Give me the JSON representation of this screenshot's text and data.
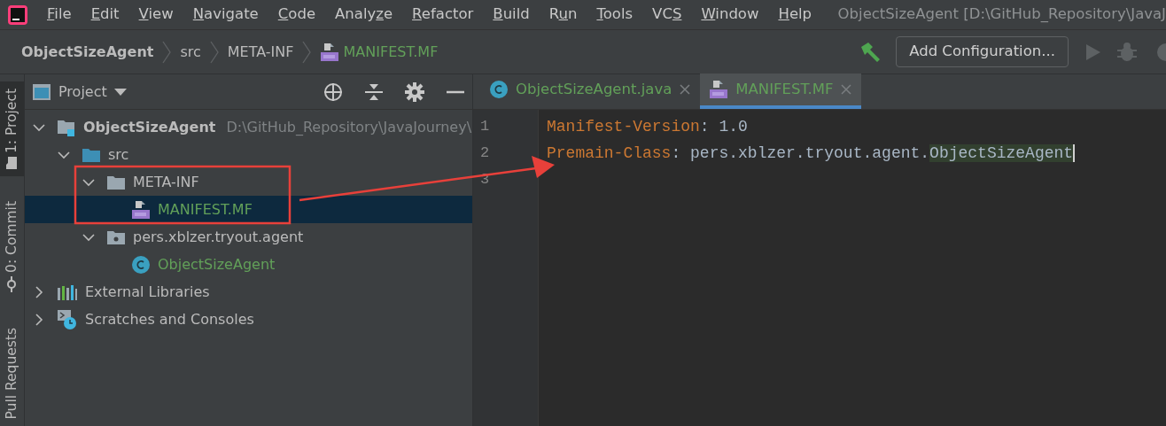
{
  "menu_bar": {
    "items": [
      {
        "mnemonic": "F",
        "after": "ile"
      },
      {
        "mnemonic": "E",
        "after": "dit"
      },
      {
        "mnemonic": "V",
        "after": "iew"
      },
      {
        "mnemonic": "N",
        "after": "avigate"
      },
      {
        "mnemonic": "C",
        "after": "ode"
      },
      {
        "before": "Analy",
        "mnemonic": "z",
        "after": "e"
      },
      {
        "mnemonic": "R",
        "after": "efactor"
      },
      {
        "mnemonic": "B",
        "after": "uild"
      },
      {
        "before": "R",
        "mnemonic": "u",
        "after": "n"
      },
      {
        "mnemonic": "T",
        "after": "ools"
      },
      {
        "before": "VC",
        "mnemonic": "S"
      },
      {
        "mnemonic": "W",
        "after": "indow"
      },
      {
        "mnemonic": "H",
        "after": "elp"
      }
    ],
    "window_title": "ObjectSizeAgent [D:\\GitHub_Repository\\JavaJ"
  },
  "breadcrumbs": [
    {
      "label": "ObjectSizeAgent",
      "kind": "project"
    },
    {
      "label": "src",
      "kind": "folder"
    },
    {
      "label": "META-INF",
      "kind": "folder"
    },
    {
      "label": "MANIFEST.MF",
      "kind": "manifest"
    }
  ],
  "toolbar": {
    "config_button": "Add Configuration..."
  },
  "side_tabs": [
    {
      "label": "1: Project",
      "kind": "project",
      "selected": true
    },
    {
      "label": "0: Commit",
      "kind": "commit",
      "selected": false
    },
    {
      "label": "Pull Requests",
      "kind": "pull",
      "selected": false
    }
  ],
  "project_panel": {
    "title": "Project",
    "tree": [
      {
        "label": "ObjectSizeAgent",
        "kind": "module",
        "path": "D:\\GitHub_Repository\\JavaJourney\\",
        "expanded": true,
        "selected": false,
        "children": [
          {
            "label": "src",
            "kind": "source_folder",
            "expanded": true,
            "selected": false,
            "children": [
              {
                "label": "META-INF",
                "kind": "folder",
                "expanded": true,
                "selected": false,
                "children": [
                  {
                    "label": "MANIFEST.MF",
                    "kind": "manifest",
                    "selected": true
                  }
                ]
              },
              {
                "label": "pers.xblzer.tryout.agent",
                "kind": "package",
                "expanded": true,
                "selected": false,
                "children": [
                  {
                    "label": "ObjectSizeAgent",
                    "kind": "class",
                    "selected": false
                  }
                ]
              }
            ]
          }
        ]
      },
      {
        "label": "External Libraries",
        "kind": "libraries",
        "expanded": false,
        "selected": false
      },
      {
        "label": "Scratches and Consoles",
        "kind": "scratches",
        "expanded": false,
        "selected": false
      }
    ]
  },
  "editor": {
    "tabs": [
      {
        "label": "ObjectSizeAgent.java",
        "kind": "class",
        "selected": false
      },
      {
        "label": "MANIFEST.MF",
        "kind": "manifest",
        "selected": true
      }
    ],
    "lines": [
      {
        "number": "1",
        "tokens": [
          {
            "text": "Manifest-Version",
            "kind": "key"
          },
          {
            "text": ": 1.0",
            "kind": "plain"
          }
        ]
      },
      {
        "number": "2",
        "tokens": [
          {
            "text": "Premain-Class",
            "kind": "key"
          },
          {
            "text": ": pers.xblzer.tryout.agent.",
            "kind": "plain"
          },
          {
            "text": "ObjectSizeAgent",
            "kind": "highlight"
          }
        ]
      },
      {
        "number": "3"
      }
    ]
  }
}
